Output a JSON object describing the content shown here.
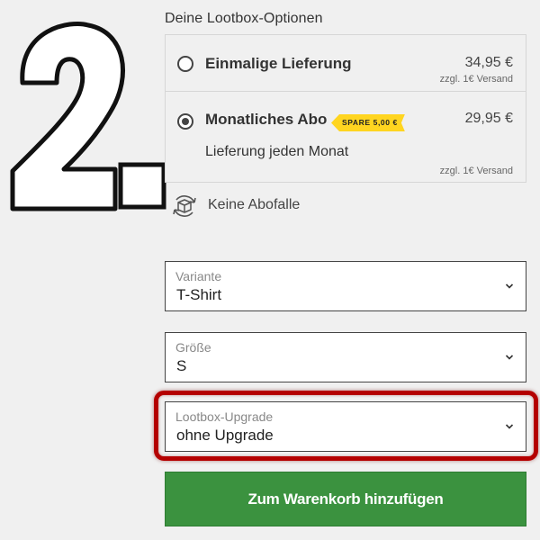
{
  "step": {
    "number_icon": "step-2-numeral",
    "text": "2."
  },
  "options": {
    "title": "Deine Lootbox-Optionen",
    "items": [
      {
        "name": "Einmalige Lieferung",
        "price": "34,95 €",
        "shipping": "zzgl. 1€ Versand",
        "selected": false
      },
      {
        "name": "Monatliches Abo",
        "badge": "SPARE 5,00 €",
        "subtitle": "Lieferung jeden Monat",
        "price": "29,95 €",
        "shipping": "zzgl. 1€ Versand",
        "selected": true
      }
    ]
  },
  "no_trap": {
    "icon": "box-cycle-icon",
    "label": "Keine Abofalle"
  },
  "selects": {
    "variant": {
      "label": "Variante",
      "value": "T-Shirt"
    },
    "size": {
      "label": "Größe",
      "value": "S"
    },
    "upgrade": {
      "label": "Lootbox-Upgrade",
      "value": "ohne Upgrade"
    }
  },
  "cart": {
    "label": "Zum Warenkorb hinzufügen"
  },
  "colors": {
    "background": "#f0f0f0",
    "accent_green": "#3b923f",
    "badge_yellow": "#ffd520",
    "highlight_red": "#b40000"
  }
}
